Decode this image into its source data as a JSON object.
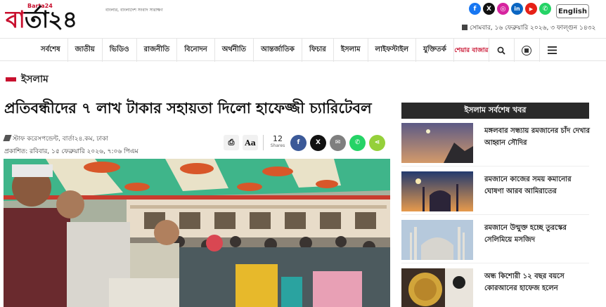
{
  "header": {
    "logo_tag": "Barta24",
    "logo_text_red": "বা",
    "logo_text_dark": "র্তা২৪",
    "slogan": "বাংলার, বাংলাদেশ সংবাদ সারাক্ষণ",
    "english_button": "English",
    "date_line": "সোমবার, ১৬ ফেব্রুয়ারি ২০২৬, ৩ ফাল্গুন ১৪৩২",
    "social": [
      {
        "icon": "facebook-icon",
        "glyph": "f",
        "color": "#1877f2"
      },
      {
        "icon": "x-icon",
        "glyph": "X",
        "color": "#111111"
      },
      {
        "icon": "instagram-icon",
        "glyph": "◎",
        "color": "#d6249f"
      },
      {
        "icon": "linkedin-icon",
        "glyph": "in",
        "color": "#0a66c2"
      },
      {
        "icon": "youtube-icon",
        "glyph": "▶",
        "color": "#e62117"
      },
      {
        "icon": "whatsapp-icon",
        "glyph": "✆",
        "color": "#25d366"
      }
    ]
  },
  "nav": {
    "items": [
      "সর্বশেষ",
      "জাতীয়",
      "ভিডিও",
      "রাজনীতি",
      "বিনোদন",
      "অর্থনীতি",
      "আন্তর্জাতিক",
      "ফিচার",
      "ইসলাম",
      "লাইফস্টাইল",
      "যুক্তিতর্ক"
    ],
    "shoshe_label": "শেয়ার বাজার"
  },
  "article": {
    "section": "ইসলাম",
    "headline": "প্রতিবন্ধীদের ৭ লাখ টাকার সহায়তা দিলো হাফেজ্জী চ্যারিটেবল",
    "byline": "স্টাফ করেসপন্ডেন্ট, বার্তা২৪.কম, ঢাকা",
    "published": "প্রকাশিত: রবিবার, ১৫ ফেব্রুয়ারি ২০২৬, ৭:০৬ পিএম",
    "share_count": "12",
    "share_label": "Shares",
    "print_glyph": "⎙",
    "font_glyph": "Aa"
  },
  "share_buttons": [
    {
      "icon": "facebook-share-icon",
      "glyph": "f",
      "color": "#3b5998"
    },
    {
      "icon": "x-share-icon",
      "glyph": "X",
      "color": "#111111"
    },
    {
      "icon": "email-share-icon",
      "glyph": "✉",
      "color": "#7f7f7f"
    },
    {
      "icon": "whatsapp-share-icon",
      "glyph": "✆",
      "color": "#25d366"
    },
    {
      "icon": "sharethis-icon",
      "glyph": "⋖",
      "color": "#95d03a"
    }
  ],
  "sidebar": {
    "heading": "ইসলাম সর্বশেষ খবর",
    "items": [
      {
        "title": "মঙ্গলবার সন্ধ্যায় রমজানের চাঁদ দেখার আহ্বান সৌদির"
      },
      {
        "title": "রমজানে কাজের সময় কমানোর ঘোষণা আরব আমিরাতের"
      },
      {
        "title": "রমজানে উন্মুক্ত হচ্ছে তুরস্কের সেলিমিয়ে মসজিদ"
      },
      {
        "title": "অন্ধ কিশোরী ১২ বছর বয়সে কোরআনের হাফেজ হলেন"
      }
    ]
  },
  "colors": {
    "brand_red": "#c8102e",
    "sidebar_header": "#2a2a2a"
  }
}
